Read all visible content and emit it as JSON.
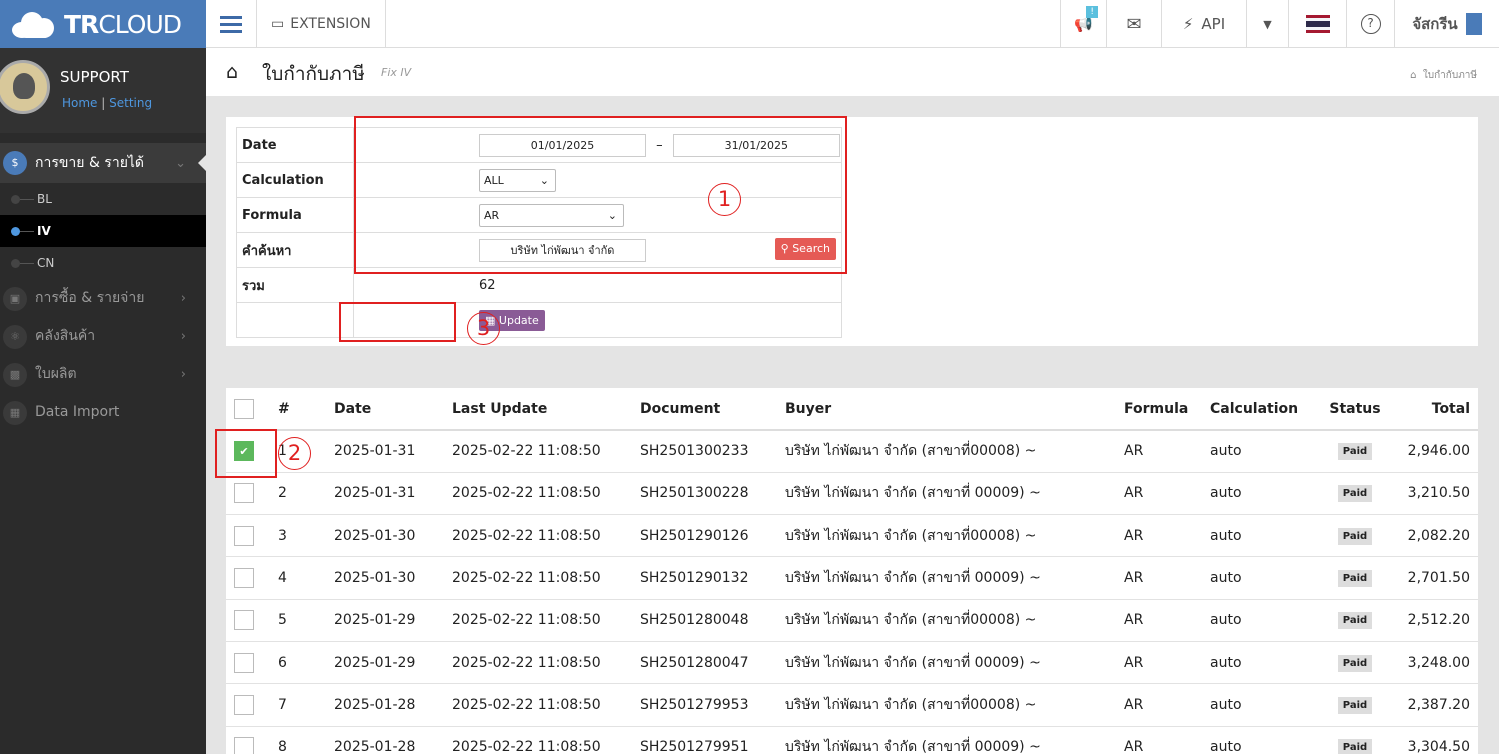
{
  "brand": {
    "prefix": "TR",
    "suffix": "CLOUD"
  },
  "user": {
    "name": "SUPPORT",
    "home": "Home",
    "sep": "|",
    "setting": "Setting"
  },
  "sidebar": {
    "active": {
      "label": "การขาย & รายได้",
      "icon": "$"
    },
    "subs": [
      {
        "label": "BL"
      },
      {
        "label": "IV"
      },
      {
        "label": "CN"
      }
    ],
    "items": [
      {
        "label": "การซื้อ & รายจ่าย"
      },
      {
        "label": "คลังสินค้า"
      },
      {
        "label": "ใบผลิต"
      },
      {
        "label": "Data Import"
      }
    ]
  },
  "topbar": {
    "extension": "EXTENSION",
    "api": "API",
    "username": "จัสกรีน",
    "notif_badge": "!"
  },
  "page": {
    "title": "ใบกำกับภาษี",
    "subtitle": "Fix IV",
    "breadcrumb": "ใบกำกับภาษี"
  },
  "filter": {
    "date_label": "Date",
    "date_from": "01/01/2025",
    "date_sep": "–",
    "date_to": "31/01/2025",
    "calc_label": "Calculation",
    "calc_value": "ALL",
    "formula_label": "Formula",
    "formula_value": "AR",
    "search_label": "คำค้นหา",
    "search_value": "บริษัท ไก่พัฒนา จำกัด",
    "search_button": "Search",
    "total_label": "รวม",
    "total_value": "62",
    "update_button": "Update"
  },
  "annotations": [
    "1",
    "2",
    "3"
  ],
  "table": {
    "headers": [
      "#",
      "Date",
      "Last Update",
      "Document",
      "Buyer",
      "Formula",
      "Calculation",
      "Status",
      "Total"
    ],
    "rows": [
      {
        "no": "1",
        "date": "2025-01-31",
        "updated": "2025-02-22 11:08:50",
        "doc": "SH2501300233",
        "buyer": "บริษัท ไก่พัฒนา จำกัด (สาขาที่00008) ~",
        "formula": "AR",
        "calc": "auto",
        "status": "Paid",
        "total": "2,946.00",
        "checked": true
      },
      {
        "no": "2",
        "date": "2025-01-31",
        "updated": "2025-02-22 11:08:50",
        "doc": "SH2501300228",
        "buyer": "บริษัท ไก่พัฒนา จำกัด (สาขาที่ 00009) ~",
        "formula": "AR",
        "calc": "auto",
        "status": "Paid",
        "total": "3,210.50",
        "checked": false
      },
      {
        "no": "3",
        "date": "2025-01-30",
        "updated": "2025-02-22 11:08:50",
        "doc": "SH2501290126",
        "buyer": "บริษัท ไก่พัฒนา จำกัด (สาขาที่00008) ~",
        "formula": "AR",
        "calc": "auto",
        "status": "Paid",
        "total": "2,082.20",
        "checked": false
      },
      {
        "no": "4",
        "date": "2025-01-30",
        "updated": "2025-02-22 11:08:50",
        "doc": "SH2501290132",
        "buyer": "บริษัท ไก่พัฒนา จำกัด (สาขาที่ 00009) ~",
        "formula": "AR",
        "calc": "auto",
        "status": "Paid",
        "total": "2,701.50",
        "checked": false
      },
      {
        "no": "5",
        "date": "2025-01-29",
        "updated": "2025-02-22 11:08:50",
        "doc": "SH2501280048",
        "buyer": "บริษัท ไก่พัฒนา จำกัด (สาขาที่00008) ~",
        "formula": "AR",
        "calc": "auto",
        "status": "Paid",
        "total": "2,512.20",
        "checked": false
      },
      {
        "no": "6",
        "date": "2025-01-29",
        "updated": "2025-02-22 11:08:50",
        "doc": "SH2501280047",
        "buyer": "บริษัท ไก่พัฒนา จำกัด (สาขาที่ 00009) ~",
        "formula": "AR",
        "calc": "auto",
        "status": "Paid",
        "total": "3,248.00",
        "checked": false
      },
      {
        "no": "7",
        "date": "2025-01-28",
        "updated": "2025-02-22 11:08:50",
        "doc": "SH2501279953",
        "buyer": "บริษัท ไก่พัฒนา จำกัด (สาขาที่00008) ~",
        "formula": "AR",
        "calc": "auto",
        "status": "Paid",
        "total": "2,387.20",
        "checked": false
      },
      {
        "no": "8",
        "date": "2025-01-28",
        "updated": "2025-02-22 11:08:50",
        "doc": "SH2501279951",
        "buyer": "บริษัท ไก่พัฒนา จำกัด (สาขาที่ 00009) ~",
        "formula": "AR",
        "calc": "auto",
        "status": "Paid",
        "total": "3,304.50",
        "checked": false
      }
    ]
  },
  "colors": {
    "brand": "#4a7bb8",
    "sidebar": "#2b2b2b",
    "search": "#e55a55",
    "update": "#8a5b96",
    "check": "#5cb85c",
    "annotation": "#e02020"
  }
}
